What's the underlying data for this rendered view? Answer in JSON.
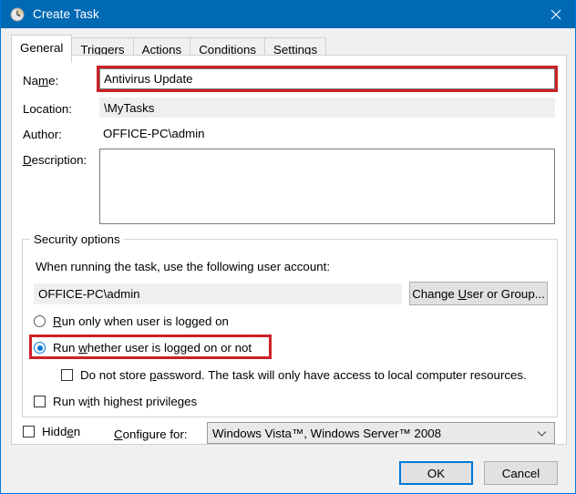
{
  "window": {
    "title": "Create Task",
    "icon": "clock-icon",
    "close_label": "Close",
    "titlebar_color": "#0069b4",
    "accent_color": "#0078d7",
    "highlight_color": "#cc2127"
  },
  "tabs": [
    {
      "label": "General",
      "active": true
    },
    {
      "label": "Triggers",
      "active": false
    },
    {
      "label": "Actions",
      "active": false
    },
    {
      "label": "Conditions",
      "active": false
    },
    {
      "label": "Settings",
      "active": false
    }
  ],
  "general": {
    "name_label_pre": "Na",
    "name_label_acc": "m",
    "name_label_post": "e:",
    "name_value": "Antivirus Update",
    "location_label": "Location:",
    "location_value": "\\MyTasks",
    "author_label": "Author:",
    "author_value": "OFFICE-PC\\admin",
    "description_label_acc": "D",
    "description_label_post": "escription:",
    "description_value": "",
    "description_placeholder": ""
  },
  "security": {
    "group_title": "Security options",
    "account_prompt": "When running the task, use the following user account:",
    "account_value": "OFFICE-PC\\admin",
    "change_user_pre": "Change ",
    "change_user_acc": "U",
    "change_user_post": "ser or Group...",
    "radio_logged_on": {
      "pre": "",
      "acc": "R",
      "post": "un only when user is logged on",
      "checked": false
    },
    "radio_whether": {
      "pre": "Run ",
      "acc": "w",
      "post": "hether user is logged on or not",
      "checked": true,
      "highlighted": true
    },
    "checkbox_no_password": {
      "pre": "Do not store ",
      "acc": "p",
      "post": "assword.  The task will only have access to local computer resources.",
      "checked": false
    },
    "checkbox_highest_privileges": {
      "pre": "Run w",
      "acc": "i",
      "post": "th highest privileges",
      "checked": false
    }
  },
  "bottom_options": {
    "hidden_pre": "Hidd",
    "hidden_acc": "e",
    "hidden_post": "n",
    "hidden_checked": false,
    "configure_pre": "",
    "configure_acc": "C",
    "configure_post": "onfigure for:",
    "configure_value": "Windows Vista™, Windows Server™ 2008",
    "configure_chevron": "chevron-down-icon"
  },
  "footer": {
    "ok_label": "OK",
    "cancel_label": "Cancel"
  }
}
